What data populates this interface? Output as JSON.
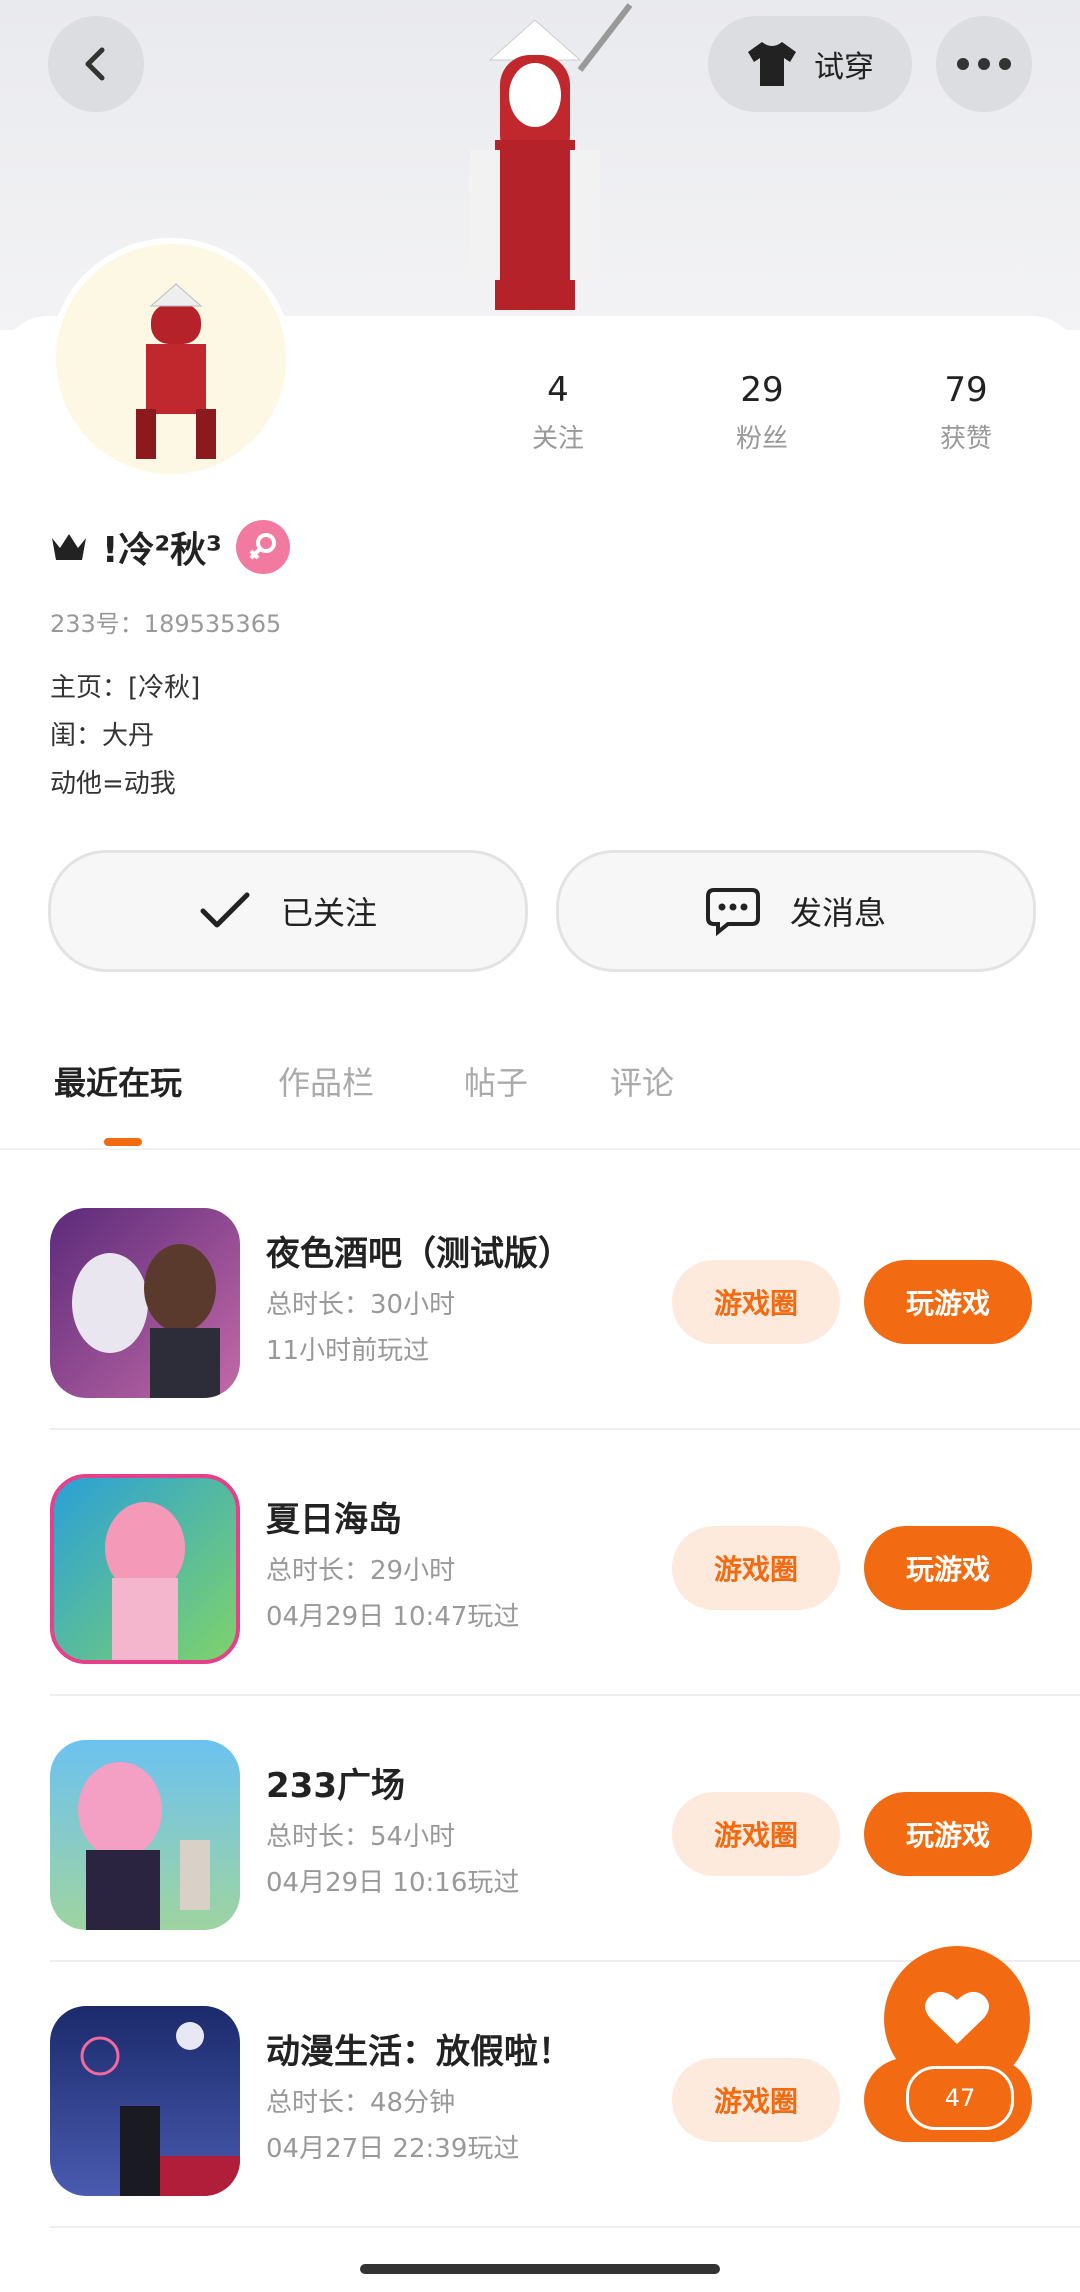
{
  "header": {
    "tryon_label": "试穿"
  },
  "stats": [
    {
      "value": "4",
      "label": "关注"
    },
    {
      "value": "29",
      "label": "粉丝"
    },
    {
      "value": "79",
      "label": "获赞"
    }
  ],
  "profile": {
    "name": "!冷²秋³",
    "uid": "233号：189535365",
    "bio": "主页：[冷秋]\n闺：大丹\n动他=动我"
  },
  "actions": {
    "follow_label": "已关注",
    "message_label": "发消息"
  },
  "tabs": [
    "最近在玩",
    "作品栏",
    "帖子",
    "评论"
  ],
  "games": [
    {
      "title": "夜色酒吧（测试版）",
      "total": "总时长：30小时",
      "last": "11小时前玩过"
    },
    {
      "title": "夏日海岛",
      "total": "总时长：29小时",
      "last": "04月29日 10:47玩过"
    },
    {
      "title": "233广场",
      "total": "总时长：54小时",
      "last": "04月29日 10:16玩过"
    },
    {
      "title": "动漫生活：放假啦！",
      "total": "总时长：48分钟",
      "last": "04月27日 22:39玩过"
    }
  ],
  "buttons": {
    "circle": "游戏圈",
    "play": "玩游戏"
  },
  "like": {
    "count": "47"
  },
  "colors": {
    "accent": "#f26b12",
    "accent_light": "#feeadd",
    "gender_pink": "#f27aa0"
  }
}
